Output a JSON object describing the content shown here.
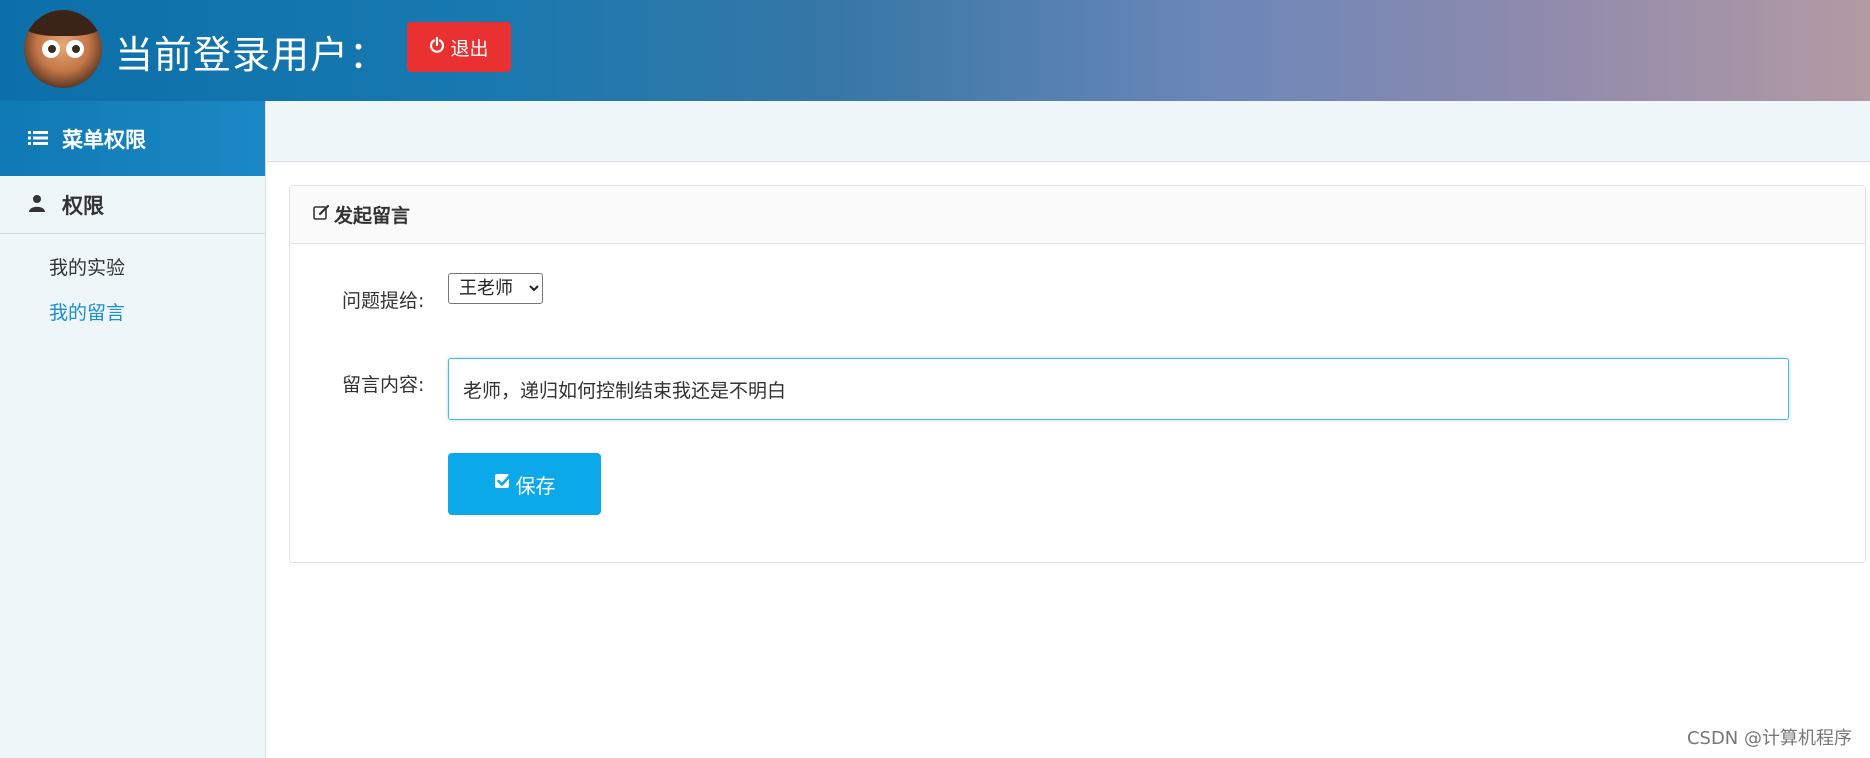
{
  "header": {
    "title": "当前登录用户：",
    "logout_label": "退出"
  },
  "sidebar": {
    "menu_title": "菜单权限",
    "group_title": "权限",
    "items": [
      {
        "label": "我的实验",
        "active": false
      },
      {
        "label": "我的留言",
        "active": true
      }
    ]
  },
  "panel": {
    "title": "发起留言",
    "to_label": "问题提给:",
    "to_selected": "王老师",
    "content_label": "留言内容:",
    "content_value": "老师，递归如何控制结束我还是不明白",
    "save_label": "保存"
  },
  "watermark": "CSDN @计算机程序",
  "colors": {
    "header_start": "#0d6fa9",
    "header_end": "#b39aa3",
    "logout_red": "#e93131",
    "save_blue": "#0ba8ea",
    "active_link": "#1b8fc6"
  },
  "icons": {
    "logout": "power-icon",
    "menu": "list-icon",
    "group": "user-icon",
    "panel": "edit-icon",
    "save": "check-square-icon"
  }
}
